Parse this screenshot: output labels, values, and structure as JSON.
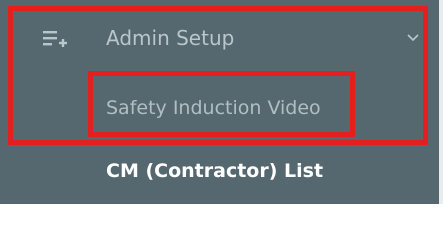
{
  "sidebar": {
    "admin_setup": {
      "label": "Admin Setup",
      "icon": "playlist-add-icon",
      "expand_icon": "chevron-down-icon"
    },
    "items": [
      {
        "label": "Safety Induction Video"
      },
      {
        "label": "CM (Contractor) List"
      }
    ]
  },
  "colors": {
    "sidebar_bg": "#55686f",
    "highlight": "#e31f1f",
    "muted_text": "#b9c7cb",
    "active_text": "#ffffff"
  }
}
